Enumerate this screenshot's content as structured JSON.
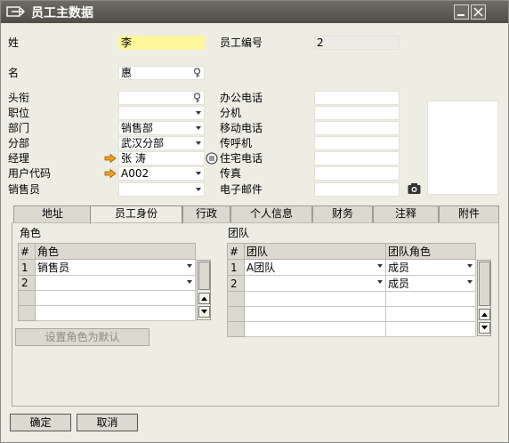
{
  "window": {
    "title": "员工主数据"
  },
  "form": {
    "last_name_label": "姓",
    "last_name_value": "李",
    "first_name_label": "名",
    "first_name_value": "惠",
    "emp_no_label": "员工编号",
    "emp_no_value": "2",
    "title_label": "头衔",
    "position_label": "职位",
    "department_label": "部门",
    "department_value": "销售部",
    "branch_label": "分部",
    "branch_value": "武汉分部",
    "manager_label": "经理",
    "manager_value": "张 涛",
    "user_code_label": "用户代码",
    "user_code_value": "A002",
    "salesperson_label": "销售员",
    "office_phone_label": "办公电话",
    "extension_label": "分机",
    "mobile_label": "移动电话",
    "pager_label": "传呼机",
    "home_phone_label": "住宅电话",
    "fax_label": "传真",
    "email_label": "电子邮件"
  },
  "tabs": [
    "地址",
    "员工身份",
    "行政",
    "个人信息",
    "财务",
    "注释",
    "附件"
  ],
  "roles": {
    "section_label": "角色",
    "col_num": "#",
    "col_role": "角色",
    "rows": [
      {
        "num": "1",
        "role": "销售员"
      },
      {
        "num": "2",
        "role": ""
      }
    ],
    "set_default_button": "设置角色为默认"
  },
  "teams": {
    "section_label": "团队",
    "col_num": "#",
    "col_team": "团队",
    "col_team_role": "团队角色",
    "rows": [
      {
        "num": "1",
        "team": "A团队",
        "team_role": "成员"
      },
      {
        "num": "2",
        "team": "",
        "team_role": "成员"
      }
    ]
  },
  "buttons": {
    "ok": "确定",
    "cancel": "取消"
  },
  "colors": {
    "titlebar": "#5e5c55",
    "mandatory_field": "#fff59a",
    "link_arrow": "#f0a020"
  }
}
